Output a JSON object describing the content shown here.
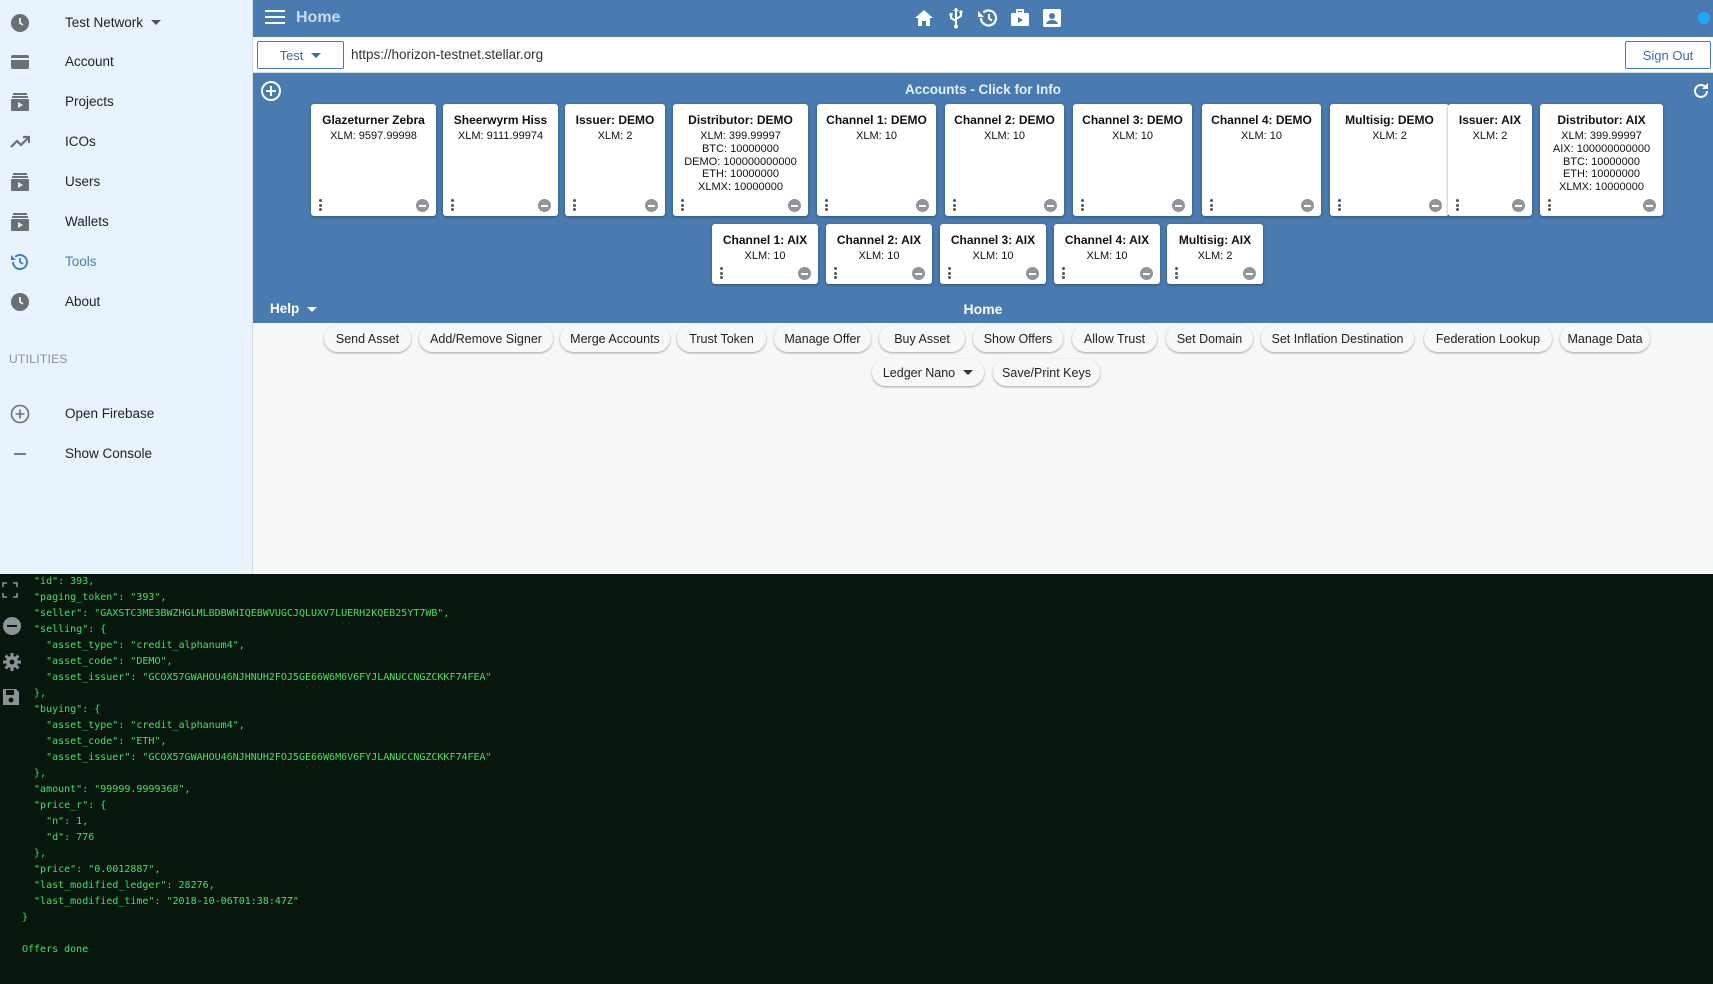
{
  "sidebar": {
    "network": {
      "label": "Test Network"
    },
    "items": [
      {
        "label": "Account",
        "icon": "account-card-icon"
      },
      {
        "label": "Projects",
        "icon": "projects-stack-icon"
      },
      {
        "label": "ICOs",
        "icon": "trending-up-icon"
      },
      {
        "label": "Users",
        "icon": "users-stack-icon"
      },
      {
        "label": "Wallets",
        "icon": "wallets-stack-icon"
      },
      {
        "label": "Tools",
        "icon": "history-icon",
        "active": true
      },
      {
        "label": "About",
        "icon": "clock-icon"
      }
    ],
    "utilities_heading": "UTILITIES",
    "utilities": [
      {
        "label": "Open Firebase",
        "icon": "add-circle-icon"
      },
      {
        "label": "Show Console",
        "icon": "minus-icon"
      }
    ]
  },
  "appbar": {
    "title": "Home",
    "icons": [
      "home-icon",
      "usb-icon",
      "history-icon",
      "briefcase-icon",
      "contact-icon"
    ],
    "status_color": "#1fa8ff"
  },
  "urlbar": {
    "network_select": "Test",
    "url": "https://horizon-testnet.stellar.org",
    "signout_label": "Sign Out"
  },
  "accounts": {
    "title": "Accounts - Click for Info",
    "cards": [
      {
        "name": "Glazeturner Zebra",
        "balances": [
          "XLM: 9597.99998"
        ]
      },
      {
        "name": "Sheerwyrm Hiss",
        "balances": [
          "XLM: 9111.99974"
        ]
      },
      {
        "name": "Issuer: DEMO",
        "balances": [
          "XLM: 2"
        ]
      },
      {
        "name": "Distributor: DEMO",
        "balances": [
          "XLM: 399.99997",
          "BTC: 10000000",
          "DEMO: 100000000000",
          "ETH: 10000000",
          "XLMX: 10000000"
        ]
      },
      {
        "name": "Channel 1: DEMO",
        "balances": [
          "XLM: 10"
        ]
      },
      {
        "name": "Channel 2: DEMO",
        "balances": [
          "XLM: 10"
        ]
      },
      {
        "name": "Channel 3: DEMO",
        "balances": [
          "XLM: 10"
        ]
      },
      {
        "name": "Channel 4: DEMO",
        "balances": [
          "XLM: 10"
        ]
      },
      {
        "name": "Multisig: DEMO",
        "balances": [
          "XLM: 2"
        ]
      },
      {
        "name": "Issuer: AIX",
        "balances": [
          "XLM: 2"
        ]
      },
      {
        "name": "Distributor: AIX",
        "balances": [
          "XLM: 399.99997",
          "AIX: 100000000000",
          "BTC: 10000000",
          "ETH: 10000000",
          "XLMX: 10000000"
        ]
      },
      {
        "name": "Channel 1: AIX",
        "balances": [
          "XLM: 10"
        ]
      },
      {
        "name": "Channel 2: AIX",
        "balances": [
          "XLM: 10"
        ]
      },
      {
        "name": "Channel 3: AIX",
        "balances": [
          "XLM: 10"
        ]
      },
      {
        "name": "Channel 4: AIX",
        "balances": [
          "XLM: 10"
        ]
      },
      {
        "name": "Multisig: AIX",
        "balances": [
          "XLM: 2"
        ]
      }
    ]
  },
  "helpbar": {
    "help_label": "Help",
    "home_label": "Home"
  },
  "actions": {
    "buttons": [
      "Send Asset",
      "Add/Remove Signer",
      "Merge Accounts",
      "Trust Token",
      "Manage Offer",
      "Buy Asset",
      "Show Offers",
      "Allow Trust",
      "Set Domain",
      "Set Inflation Destination",
      "Federation Lookup",
      "Manage Data"
    ],
    "dropdown": "Ledger Nano",
    "save_keys": "Save/Print Keys"
  },
  "console": {
    "tools": [
      "fullscreen-icon",
      "clear-icon",
      "settings-icon",
      "save-icon"
    ],
    "lines": [
      "  \"id\": 393,",
      "  \"paging_token\": \"393\",",
      "  \"seller\": \"GAXSTC3ME3BWZHGLMLBDBWHIQEBWVUGCJQLUXV7LUERH2KQEB25YT7WB\",",
      "  \"selling\": {",
      "    \"asset_type\": \"credit_alphanum4\",",
      "    \"asset_code\": \"DEMO\",",
      "    \"asset_issuer\": \"GCOX57GWAHOU46NJHNUH2FOJ5GE66W6M6V6FYJLANUCCNGZCKKF74FEA\"",
      "  },",
      "  \"buying\": {",
      "    \"asset_type\": \"credit_alphanum4\",",
      "    \"asset_code\": \"ETH\",",
      "    \"asset_issuer\": \"GCOX57GWAHOU46NJHNUH2FOJ5GE66W6M6V6FYJLANUCCNGZCKKF74FEA\"",
      "  },",
      "  \"amount\": \"99999.9999368\",",
      "  \"price_r\": {",
      "    \"n\": 1,",
      "    \"d\": 776",
      "  },",
      "  \"price\": \"0.0012887\",",
      "  \"last_modified_ledger\": 28276,",
      "  \"last_modified_time\": \"2018-10-06T01:38:47Z\"",
      "}",
      "",
      "Offers done"
    ]
  }
}
